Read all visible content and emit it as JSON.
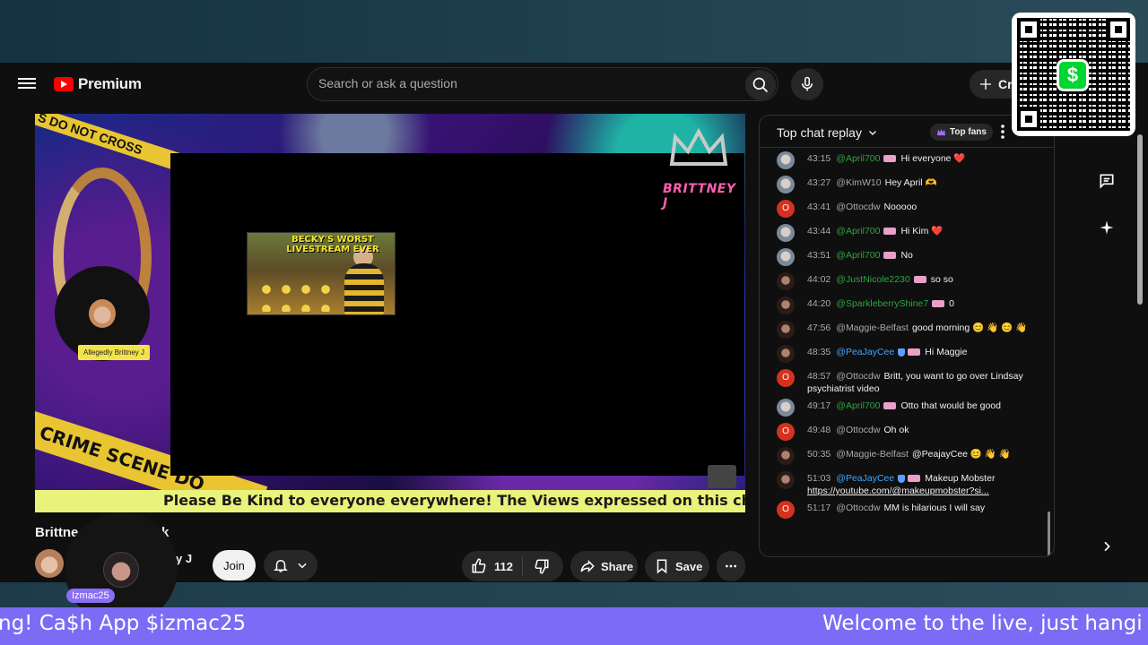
{
  "header": {
    "brand": "Premium",
    "search_placeholder": "Search or ask a question",
    "create_label": "Cr"
  },
  "video": {
    "overlay_brand": "BRITTNEY J",
    "tape_top_text": "S DO NOT CROSS",
    "tape_bottom_text": "CRIME SCENE DO",
    "thumbnail_text": "BECKY'S WORST LIVESTREAM EVER",
    "cam_label": "Allegedly Brittney J",
    "banner_text": "Please Be Kind to everyone everywhere! The Views expressed on this channel by"
  },
  "below_video": {
    "title_start": "Brittne",
    "title_end": "k",
    "channel_name_tail": "y J",
    "join_label": "Join",
    "like_count": "112",
    "share_label": "Share",
    "save_label": "Save"
  },
  "overlay": {
    "bubble_tag": "Izmac25",
    "ticker_left": "ng! Ca$h App $izmac25",
    "ticker_right": "Welcome to the live, just hangi",
    "qr_symbol": "$"
  },
  "chat": {
    "mode_label": "Top chat replay",
    "top_fans_label": "Top fans",
    "messages": [
      {
        "time": "43:15",
        "author": "@April700",
        "text": "Hi everyone ❤️"
      },
      {
        "time": "43:27",
        "author": "@KimW10",
        "text": "Hey April 🫶"
      },
      {
        "time": "43:41",
        "author": "@Ottocdw",
        "text": "Nooooo"
      },
      {
        "time": "43:44",
        "author": "@April700",
        "text": "Hi Kim ❤️"
      },
      {
        "time": "43:51",
        "author": "@April700",
        "text": "No"
      },
      {
        "time": "44:02",
        "author": "@JustNicole2230",
        "text": "so so"
      },
      {
        "time": "44:20",
        "author": "@SparkleberryShine7",
        "text": "0"
      },
      {
        "time": "47:56",
        "author": "@Maggie-Belfast",
        "text": "good morning 😊 👋 😊 👋"
      },
      {
        "time": "48:35",
        "author": "@PeaJayCee",
        "text": "Hi Maggie"
      },
      {
        "time": "48:57",
        "author": "@Ottocdw",
        "text": "Britt, you want to go over Lindsay psychiatrist video"
      },
      {
        "time": "49:17",
        "author": "@April700",
        "text": "Otto that would be good"
      },
      {
        "time": "49:48",
        "author": "@Ottocdw",
        "text": "Oh ok"
      },
      {
        "time": "50:35",
        "author": "@Maggie-Belfast",
        "text": "@PeajayCee 😊 👋 👋"
      },
      {
        "time": "51:03",
        "author": "@PeaJayCee",
        "text": "Makeup Mobster ",
        "link": "https://youtube.com/@makeupmobster?si..."
      },
      {
        "time": "51:17",
        "author": "@Ottocdw",
        "text": "MM is hilarious I will say"
      }
    ]
  },
  "colors": {
    "youtube_red": "#ff0000",
    "member_green": "#2ba640",
    "mod_blue": "#3ea6ff",
    "ticker_purple": "#7b6cf6",
    "banner_yellow": "#e9f27a",
    "cashapp_green": "#00d632"
  },
  "icons": [
    "menu-icon",
    "youtube-logo-icon",
    "search-icon",
    "mic-icon",
    "plus-icon",
    "chevron-down-icon",
    "crown-icon",
    "more-vert-icon",
    "chat-icon",
    "sparkle-icon",
    "chevron-right-icon",
    "bell-icon",
    "thumbs-up-icon",
    "thumbs-down-icon",
    "share-icon",
    "save-icon",
    "more-horiz-icon",
    "qr-code-icon",
    "cashapp-icon"
  ]
}
